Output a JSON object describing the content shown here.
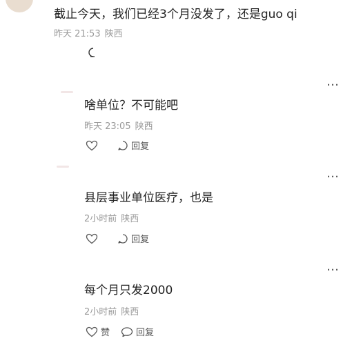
{
  "comments": [
    {
      "text": "截止今天，我们已经3个月没发了，还是guo qi",
      "time": "昨天 21:53",
      "location": "陕西"
    },
    {
      "text": "啥单位？不可能吧",
      "time": "昨天 23:05",
      "location": "陕西",
      "reply_label": "回复"
    },
    {
      "text": "县层事业单位医疗，也是",
      "time": "2小时前",
      "location": "陕西",
      "reply_label": "回复"
    },
    {
      "text": "每个月只发2000",
      "time": "2小时前",
      "location": "陕西",
      "like_label": "赞",
      "reply_label": "回复"
    }
  ],
  "more_glyph": "…"
}
